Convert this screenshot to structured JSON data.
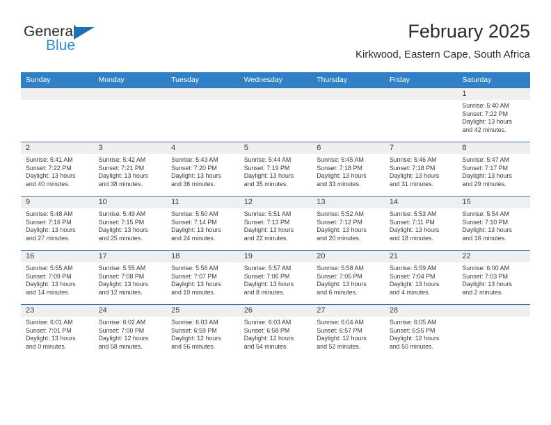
{
  "brand": {
    "name_dark": "General",
    "name_light": "Blue",
    "triangle_color": "#1f6fb5",
    "blue_color": "#2e8ed0"
  },
  "header": {
    "month_title": "February 2025",
    "location": "Kirkwood, Eastern Cape, South Africa"
  },
  "theme": {
    "header_row_bg": "#3080c8",
    "daynum_band_bg": "#efefef",
    "row_border": "#3a6fa8"
  },
  "weekday_headers": [
    "Sunday",
    "Monday",
    "Tuesday",
    "Wednesday",
    "Thursday",
    "Friday",
    "Saturday"
  ],
  "weeks": [
    [
      {
        "day": "",
        "blank": true,
        "sunrise": "",
        "sunset": "",
        "daylight_line1": "",
        "daylight_line2": ""
      },
      {
        "day": "",
        "blank": true,
        "sunrise": "",
        "sunset": "",
        "daylight_line1": "",
        "daylight_line2": ""
      },
      {
        "day": "",
        "blank": true,
        "sunrise": "",
        "sunset": "",
        "daylight_line1": "",
        "daylight_line2": ""
      },
      {
        "day": "",
        "blank": true,
        "sunrise": "",
        "sunset": "",
        "daylight_line1": "",
        "daylight_line2": ""
      },
      {
        "day": "",
        "blank": true,
        "sunrise": "",
        "sunset": "",
        "daylight_line1": "",
        "daylight_line2": ""
      },
      {
        "day": "",
        "blank": true,
        "sunrise": "",
        "sunset": "",
        "daylight_line1": "",
        "daylight_line2": ""
      },
      {
        "day": "1",
        "blank": false,
        "sunrise": "Sunrise: 5:40 AM",
        "sunset": "Sunset: 7:22 PM",
        "daylight_line1": "Daylight: 13 hours",
        "daylight_line2": "and 42 minutes."
      }
    ],
    [
      {
        "day": "2",
        "blank": false,
        "sunrise": "Sunrise: 5:41 AM",
        "sunset": "Sunset: 7:22 PM",
        "daylight_line1": "Daylight: 13 hours",
        "daylight_line2": "and 40 minutes."
      },
      {
        "day": "3",
        "blank": false,
        "sunrise": "Sunrise: 5:42 AM",
        "sunset": "Sunset: 7:21 PM",
        "daylight_line1": "Daylight: 13 hours",
        "daylight_line2": "and 38 minutes."
      },
      {
        "day": "4",
        "blank": false,
        "sunrise": "Sunrise: 5:43 AM",
        "sunset": "Sunset: 7:20 PM",
        "daylight_line1": "Daylight: 13 hours",
        "daylight_line2": "and 36 minutes."
      },
      {
        "day": "5",
        "blank": false,
        "sunrise": "Sunrise: 5:44 AM",
        "sunset": "Sunset: 7:19 PM",
        "daylight_line1": "Daylight: 13 hours",
        "daylight_line2": "and 35 minutes."
      },
      {
        "day": "6",
        "blank": false,
        "sunrise": "Sunrise: 5:45 AM",
        "sunset": "Sunset: 7:18 PM",
        "daylight_line1": "Daylight: 13 hours",
        "daylight_line2": "and 33 minutes."
      },
      {
        "day": "7",
        "blank": false,
        "sunrise": "Sunrise: 5:46 AM",
        "sunset": "Sunset: 7:18 PM",
        "daylight_line1": "Daylight: 13 hours",
        "daylight_line2": "and 31 minutes."
      },
      {
        "day": "8",
        "blank": false,
        "sunrise": "Sunrise: 5:47 AM",
        "sunset": "Sunset: 7:17 PM",
        "daylight_line1": "Daylight: 13 hours",
        "daylight_line2": "and 29 minutes."
      }
    ],
    [
      {
        "day": "9",
        "blank": false,
        "sunrise": "Sunrise: 5:48 AM",
        "sunset": "Sunset: 7:16 PM",
        "daylight_line1": "Daylight: 13 hours",
        "daylight_line2": "and 27 minutes."
      },
      {
        "day": "10",
        "blank": false,
        "sunrise": "Sunrise: 5:49 AM",
        "sunset": "Sunset: 7:15 PM",
        "daylight_line1": "Daylight: 13 hours",
        "daylight_line2": "and 25 minutes."
      },
      {
        "day": "11",
        "blank": false,
        "sunrise": "Sunrise: 5:50 AM",
        "sunset": "Sunset: 7:14 PM",
        "daylight_line1": "Daylight: 13 hours",
        "daylight_line2": "and 24 minutes."
      },
      {
        "day": "12",
        "blank": false,
        "sunrise": "Sunrise: 5:51 AM",
        "sunset": "Sunset: 7:13 PM",
        "daylight_line1": "Daylight: 13 hours",
        "daylight_line2": "and 22 minutes."
      },
      {
        "day": "13",
        "blank": false,
        "sunrise": "Sunrise: 5:52 AM",
        "sunset": "Sunset: 7:12 PM",
        "daylight_line1": "Daylight: 13 hours",
        "daylight_line2": "and 20 minutes."
      },
      {
        "day": "14",
        "blank": false,
        "sunrise": "Sunrise: 5:53 AM",
        "sunset": "Sunset: 7:11 PM",
        "daylight_line1": "Daylight: 13 hours",
        "daylight_line2": "and 18 minutes."
      },
      {
        "day": "15",
        "blank": false,
        "sunrise": "Sunrise: 5:54 AM",
        "sunset": "Sunset: 7:10 PM",
        "daylight_line1": "Daylight: 13 hours",
        "daylight_line2": "and 16 minutes."
      }
    ],
    [
      {
        "day": "16",
        "blank": false,
        "sunrise": "Sunrise: 5:55 AM",
        "sunset": "Sunset: 7:09 PM",
        "daylight_line1": "Daylight: 13 hours",
        "daylight_line2": "and 14 minutes."
      },
      {
        "day": "17",
        "blank": false,
        "sunrise": "Sunrise: 5:55 AM",
        "sunset": "Sunset: 7:08 PM",
        "daylight_line1": "Daylight: 13 hours",
        "daylight_line2": "and 12 minutes."
      },
      {
        "day": "18",
        "blank": false,
        "sunrise": "Sunrise: 5:56 AM",
        "sunset": "Sunset: 7:07 PM",
        "daylight_line1": "Daylight: 13 hours",
        "daylight_line2": "and 10 minutes."
      },
      {
        "day": "19",
        "blank": false,
        "sunrise": "Sunrise: 5:57 AM",
        "sunset": "Sunset: 7:06 PM",
        "daylight_line1": "Daylight: 13 hours",
        "daylight_line2": "and 8 minutes."
      },
      {
        "day": "20",
        "blank": false,
        "sunrise": "Sunrise: 5:58 AM",
        "sunset": "Sunset: 7:05 PM",
        "daylight_line1": "Daylight: 13 hours",
        "daylight_line2": "and 6 minutes."
      },
      {
        "day": "21",
        "blank": false,
        "sunrise": "Sunrise: 5:59 AM",
        "sunset": "Sunset: 7:04 PM",
        "daylight_line1": "Daylight: 13 hours",
        "daylight_line2": "and 4 minutes."
      },
      {
        "day": "22",
        "blank": false,
        "sunrise": "Sunrise: 6:00 AM",
        "sunset": "Sunset: 7:03 PM",
        "daylight_line1": "Daylight: 13 hours",
        "daylight_line2": "and 2 minutes."
      }
    ],
    [
      {
        "day": "23",
        "blank": false,
        "sunrise": "Sunrise: 6:01 AM",
        "sunset": "Sunset: 7:01 PM",
        "daylight_line1": "Daylight: 13 hours",
        "daylight_line2": "and 0 minutes."
      },
      {
        "day": "24",
        "blank": false,
        "sunrise": "Sunrise: 6:02 AM",
        "sunset": "Sunset: 7:00 PM",
        "daylight_line1": "Daylight: 12 hours",
        "daylight_line2": "and 58 minutes."
      },
      {
        "day": "25",
        "blank": false,
        "sunrise": "Sunrise: 6:03 AM",
        "sunset": "Sunset: 6:59 PM",
        "daylight_line1": "Daylight: 12 hours",
        "daylight_line2": "and 56 minutes."
      },
      {
        "day": "26",
        "blank": false,
        "sunrise": "Sunrise: 6:03 AM",
        "sunset": "Sunset: 6:58 PM",
        "daylight_line1": "Daylight: 12 hours",
        "daylight_line2": "and 54 minutes."
      },
      {
        "day": "27",
        "blank": false,
        "sunrise": "Sunrise: 6:04 AM",
        "sunset": "Sunset: 6:57 PM",
        "daylight_line1": "Daylight: 12 hours",
        "daylight_line2": "and 52 minutes."
      },
      {
        "day": "28",
        "blank": false,
        "sunrise": "Sunrise: 6:05 AM",
        "sunset": "Sunset: 6:55 PM",
        "daylight_line1": "Daylight: 12 hours",
        "daylight_line2": "and 50 minutes."
      },
      {
        "day": "",
        "blank": true,
        "sunrise": "",
        "sunset": "",
        "daylight_line1": "",
        "daylight_line2": ""
      }
    ]
  ]
}
